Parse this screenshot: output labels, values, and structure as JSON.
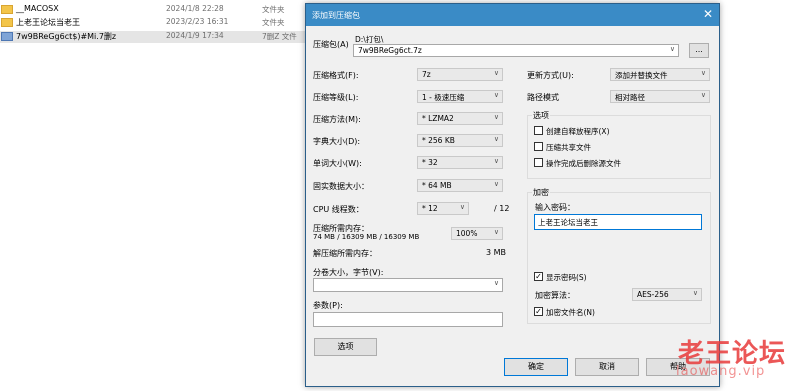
{
  "explorer": {
    "files": [
      {
        "name": "__MACOSX",
        "date": "2024/1/8 22:28",
        "type": "文件夹",
        "icon": "folder-icon"
      },
      {
        "name": "上老王论坛当老王",
        "date": "2023/2/23 16:31",
        "type": "文件夹",
        "icon": "folder-icon"
      },
      {
        "name": "7w9BReGg6ct$)#Mi.7删z",
        "date": "2024/1/9 17:34",
        "type": "7删Z 文件",
        "icon": "archive-icon"
      }
    ]
  },
  "dialog": {
    "title": "添加到压缩包",
    "close_glyph": "✕",
    "archive": {
      "label": "压缩包(A)",
      "path": "D:\\打包\\",
      "value": "7w9BReGg6ct.7z",
      "browse_label": "..."
    },
    "left": {
      "format": {
        "label": "压缩格式(F):",
        "value": "7z"
      },
      "level": {
        "label": "压缩等级(L):",
        "value": "1 - 极速压缩"
      },
      "method": {
        "label": "压缩方法(M):",
        "value": "* LZMA2"
      },
      "dict": {
        "label": "字典大小(D):",
        "value": "* 256 KB"
      },
      "word": {
        "label": "单词大小(W):",
        "value": "* 32"
      },
      "solid": {
        "label": "固实数据大小：",
        "value": "* 64 MB"
      },
      "cpu": {
        "label": "CPU 线程数：",
        "value": "* 12",
        "total": "/ 12"
      },
      "mem_compress": {
        "label": "压缩所需内存：",
        "detail": "74 MB / 16309 MB / 16309 MB",
        "percent": "100%"
      },
      "mem_decompress": {
        "label": "解压缩所需内存：",
        "value": "3 MB"
      },
      "volume": {
        "label": "分卷大小，字节(V):",
        "value": ""
      },
      "params": {
        "label": "参数(P):",
        "value": ""
      },
      "options_button": "选项"
    },
    "right": {
      "update": {
        "label": "更新方式(U):",
        "value": "添加并替换文件"
      },
      "pathmode": {
        "label": "路径模式",
        "value": "相对路径"
      },
      "options_group": "选项",
      "options": [
        {
          "label": "创建自释放程序(X)",
          "checked": false
        },
        {
          "label": "压缩共享文件",
          "checked": false
        },
        {
          "label": "操作完成后删除源文件",
          "checked": false
        }
      ],
      "encryption_group": "加密",
      "password_label": "输入密码：",
      "password_value": "上老王论坛当老王",
      "show_password": {
        "label": "显示密码(S)",
        "checked": true
      },
      "enc_method": {
        "label": "加密算法：",
        "value": "AES-256"
      },
      "encrypt_names": {
        "label": "加密文件名(N)",
        "checked": true
      }
    },
    "buttons": {
      "ok": "确定",
      "cancel": "取消",
      "help": "帮助"
    }
  },
  "watermark": {
    "text": "老王论坛",
    "url": "laowang.vip",
    "color": "#e73a3a"
  },
  "colors": {
    "titlebar": "#3a8bc6",
    "dialog_bg": "#f0f0f0",
    "accent_border": "#0078d7"
  }
}
